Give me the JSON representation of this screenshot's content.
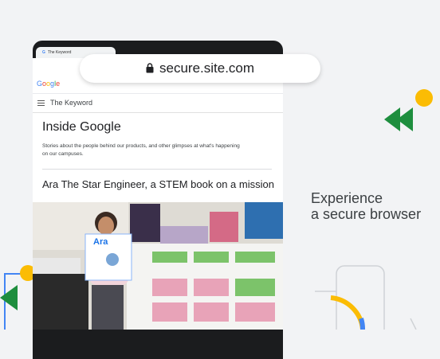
{
  "browser": {
    "tab_title": "The Keyword",
    "tab_favicon": "G",
    "url": "secure.site.com"
  },
  "page": {
    "google_logo": "Google",
    "site_title": "The Keyword",
    "section_title": "Inside Google",
    "section_description": "Stories about the people behind our products, and other glimpses at what's happening on our campuses.",
    "article_title": "Ara The Star Engineer, a STEM book on a mission",
    "photo_book_title": "Ara"
  },
  "promo": {
    "line1": "Experience",
    "line2": "a secure browser"
  },
  "colors": {
    "google_blue": "#4285f4",
    "google_red": "#ea4335",
    "google_yellow": "#fbbc04",
    "google_green": "#34a853",
    "promo_green": "#1e8e3e",
    "promo_yellow": "#fbbc04"
  },
  "icons": [
    "lock-icon",
    "menu-icon",
    "favicon-icon"
  ]
}
